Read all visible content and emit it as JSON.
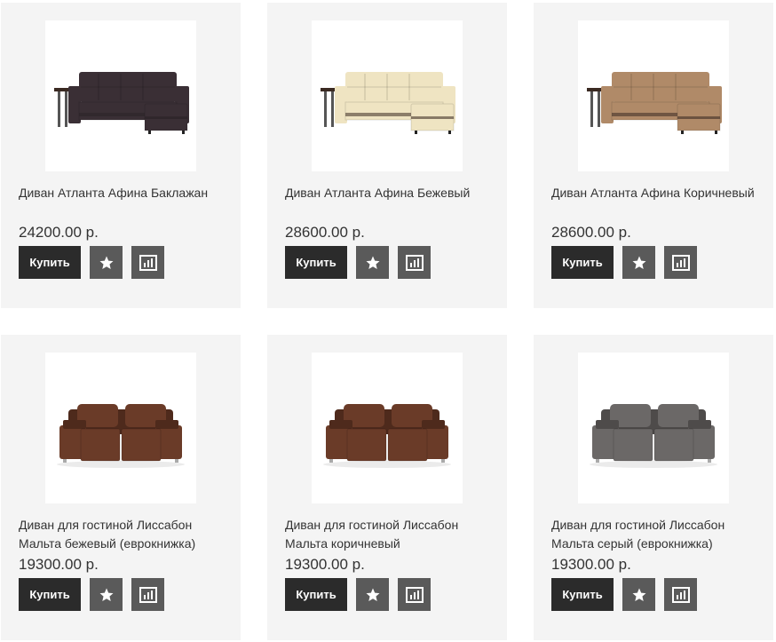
{
  "products": [
    {
      "title": "Диван Атланта Афина Баклажан",
      "price": "24200.00 р.",
      "buy_label": "Купить",
      "image": {
        "kind": "corner-sofa",
        "color": "#3a2f35",
        "accent": "#2a2226"
      },
      "favorite_icon": "star-icon",
      "compare_icon": "bar-chart-icon"
    },
    {
      "title": "Диван Атланта Афина Бежевый",
      "price": "28600.00 р.",
      "buy_label": "Купить",
      "image": {
        "kind": "corner-sofa",
        "color": "#efe4c2",
        "accent": "#3a2a22"
      },
      "favorite_icon": "star-icon",
      "compare_icon": "bar-chart-icon"
    },
    {
      "title": "Диван Атланта Афина Коричневый",
      "price": "28600.00 р.",
      "buy_label": "Купить",
      "image": {
        "kind": "corner-sofa",
        "color": "#b08a68",
        "accent": "#3a2a22"
      },
      "favorite_icon": "star-icon",
      "compare_icon": "bar-chart-icon"
    },
    {
      "title": "Диван для гостиной Лиссабон Мальта бежевый (еврокнижка)",
      "price": "19300.00 р.",
      "buy_label": "Купить",
      "image": {
        "kind": "straight-sofa",
        "color": "#6a3b28",
        "accent": "#4e2a1c"
      },
      "favorite_icon": "star-icon",
      "compare_icon": "bar-chart-icon"
    },
    {
      "title": "Диван для гостиной Лиссабон Мальта коричневый",
      "price": "19300.00 р.",
      "buy_label": "Купить",
      "image": {
        "kind": "straight-sofa",
        "color": "#6a3b28",
        "accent": "#4e2a1c"
      },
      "favorite_icon": "star-icon",
      "compare_icon": "bar-chart-icon"
    },
    {
      "title": "Диван для гостиной Лиссабон Мальта серый (еврокнижка)",
      "price": "19300.00 р.",
      "buy_label": "Купить",
      "image": {
        "kind": "straight-sofa",
        "color": "#6b6867",
        "accent": "#4e4b4a"
      },
      "favorite_icon": "star-icon",
      "compare_icon": "bar-chart-icon"
    }
  ],
  "colors": {
    "card_bg": "#f4f4f4",
    "buy_button_bg": "#2b2b2b",
    "icon_button_bg": "#5a5a5a"
  }
}
